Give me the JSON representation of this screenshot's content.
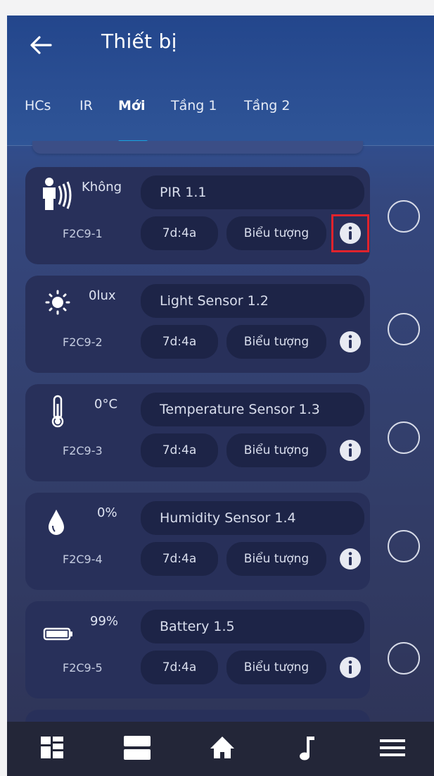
{
  "header": {
    "title": "Thiết bị"
  },
  "tabs": [
    {
      "label": "HCs",
      "active": false
    },
    {
      "label": "IR",
      "active": false
    },
    {
      "label": "Mới",
      "active": true
    },
    {
      "label": "Tầng 1",
      "active": false
    },
    {
      "label": "Tầng 2",
      "active": false
    }
  ],
  "devices": [
    {
      "icon": "person-motion-icon",
      "value": "Không",
      "id": "F2C9-1",
      "name": "PIR 1.1",
      "addr": "7d:4a",
      "icon_label": "Biểu tượng"
    },
    {
      "icon": "sun-icon",
      "value": "0lux",
      "id": "F2C9-2",
      "name": "Light Sensor 1.2",
      "addr": "7d:4a",
      "icon_label": "Biểu tượng"
    },
    {
      "icon": "thermometer-icon",
      "value": "0°C",
      "id": "F2C9-3",
      "name": "Temperature Sensor 1.3",
      "addr": "7d:4a",
      "icon_label": "Biểu tượng"
    },
    {
      "icon": "water-drop-icon",
      "value": "0%",
      "id": "F2C9-4",
      "name": "Humidity Sensor 1.4",
      "addr": "7d:4a",
      "icon_label": "Biểu tượng"
    },
    {
      "icon": "battery-icon",
      "value": "99%",
      "id": "F2C9-5",
      "name": "Battery 1.5",
      "addr": "7d:4a",
      "icon_label": "Biểu tượng"
    }
  ],
  "bottom_nav": [
    {
      "icon": "dashboard-icon"
    },
    {
      "icon": "rooms-icon"
    },
    {
      "icon": "home-icon"
    },
    {
      "icon": "music-icon"
    },
    {
      "icon": "menu-icon"
    }
  ],
  "colors": {
    "accent": "#1aa3e0",
    "highlight": "#e0232c",
    "card": "#28305a",
    "pill": "#1d2447"
  }
}
